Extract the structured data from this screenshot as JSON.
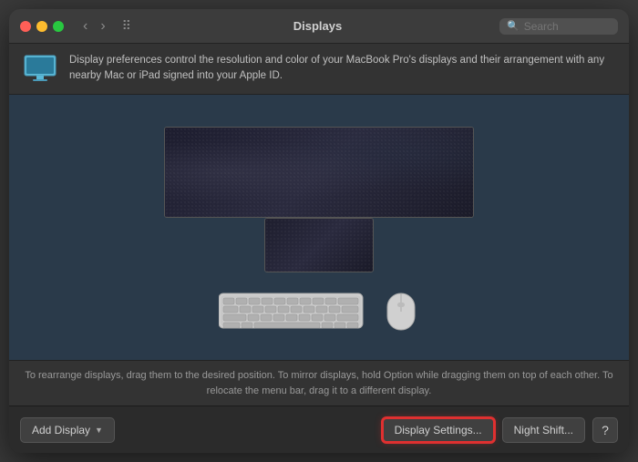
{
  "titlebar": {
    "title": "Displays",
    "search_placeholder": "Search",
    "back_icon": "‹",
    "forward_icon": "›",
    "grid_icon": "⠿"
  },
  "infobar": {
    "description": "Display preferences control the resolution and color of your MacBook Pro's displays and their arrangement with any nearby Mac or iPad signed into your Apple ID."
  },
  "instruction": {
    "text": "To rearrange displays, drag them to the desired position. To mirror displays, hold Option while dragging\nthem on top of each other. To relocate the menu bar, drag it to a different display."
  },
  "buttons": {
    "add_display": "Add Display",
    "display_settings": "Display Settings...",
    "night_shift": "Night Shift...",
    "help": "?"
  }
}
